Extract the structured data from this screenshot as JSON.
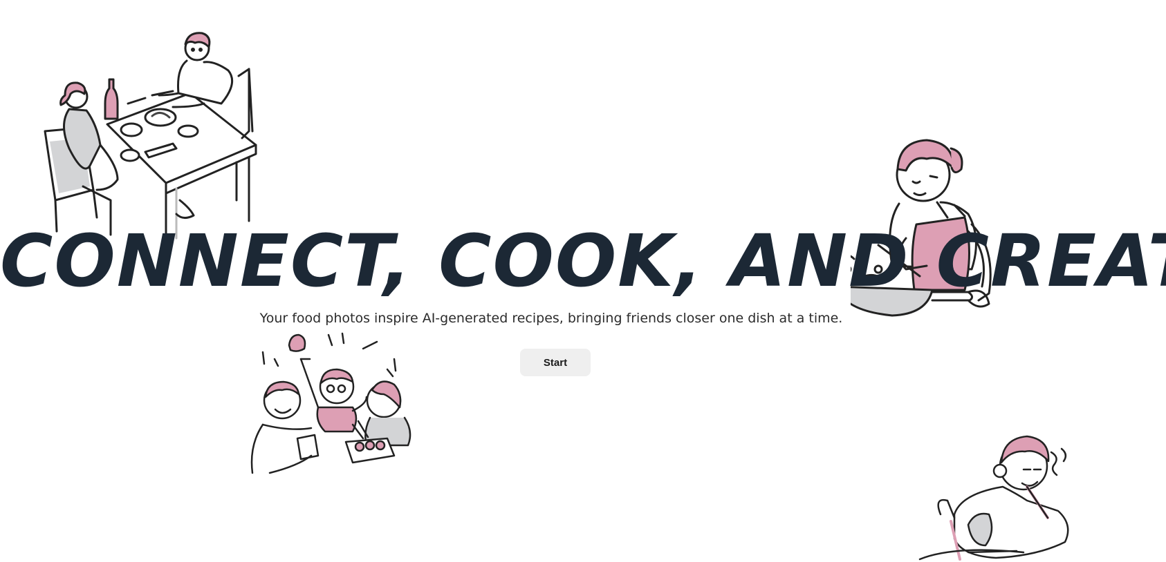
{
  "hero": {
    "title": "CONNECT, COOK, AND CREATE",
    "subtitle": "Your food photos inspire AI-generated recipes, bringing friends closer one dish at a time.",
    "start_label": "Start"
  },
  "illustrations": [
    {
      "name": "couple-dining-illustration"
    },
    {
      "name": "woman-cooking-illustration"
    },
    {
      "name": "friends-celebrating-illustration"
    },
    {
      "name": "man-eating-illustration"
    }
  ],
  "colors": {
    "background": "#ffffff",
    "title": "#1c2835",
    "accent_pink": "#dd9fb4",
    "line": "#222222",
    "shade_gray": "#d3d4d6",
    "button_bg": "#efefef"
  }
}
